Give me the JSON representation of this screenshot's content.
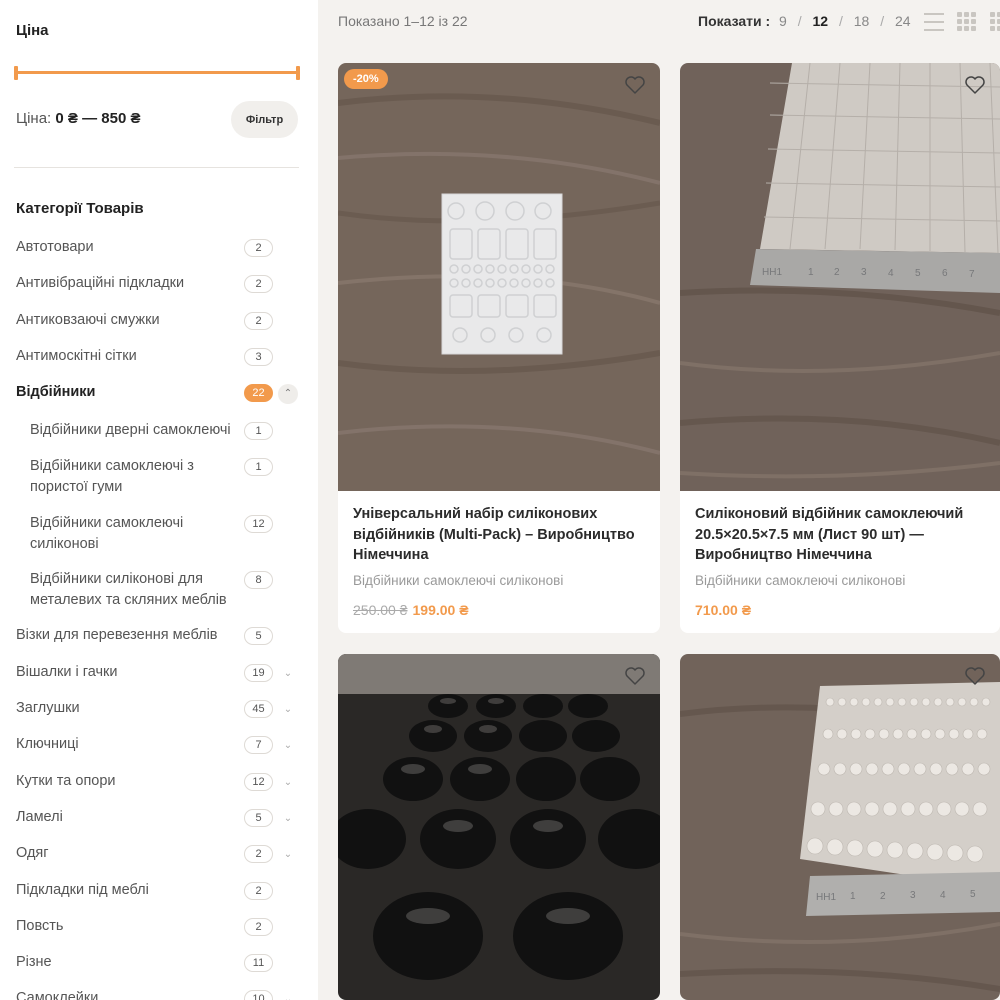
{
  "sidebar": {
    "price_title": "Ціна",
    "price_label": "Ціна:",
    "price_min": "0 ₴",
    "price_sep": "—",
    "price_max": "850 ₴",
    "filter_button": "Фільтр",
    "categories_title": "Категорії Товарів",
    "categories": [
      {
        "label": "Автотовари",
        "count": "2"
      },
      {
        "label": "Антивібраційні підкладки",
        "count": "2"
      },
      {
        "label": "Антиковзаючі смужки",
        "count": "2"
      },
      {
        "label": "Антимоскітні сітки",
        "count": "3"
      },
      {
        "label": "Відбійники",
        "count": "22"
      },
      {
        "label": "Візки для перевезення меблів",
        "count": "5"
      },
      {
        "label": "Вішалки і гачки",
        "count": "19"
      },
      {
        "label": "Заглушки",
        "count": "45"
      },
      {
        "label": "Ключниці",
        "count": "7"
      },
      {
        "label": "Кутки та опори",
        "count": "12"
      },
      {
        "label": "Ламелі",
        "count": "5"
      },
      {
        "label": "Одяг",
        "count": "2"
      },
      {
        "label": "Підкладки під меблі",
        "count": "2"
      },
      {
        "label": "Повсть",
        "count": "2"
      },
      {
        "label": "Різне",
        "count": "11"
      },
      {
        "label": "Самоклейки",
        "count": "10"
      }
    ],
    "subcategories": [
      {
        "label": "Відбійники дверні самоклеючі",
        "count": "1"
      },
      {
        "label": "Відбійники самоклеючі з пористої гуми",
        "count": "1"
      },
      {
        "label": "Відбійники самоклеючі силіконові",
        "count": "12"
      },
      {
        "label": "Відбійники силіконові для металевих та скляних меблів",
        "count": "8"
      }
    ]
  },
  "toolbar": {
    "result_count": "Показано 1–12 із 22",
    "per_page_label": "Показати :",
    "per_page_options": [
      "9",
      "12",
      "18",
      "24"
    ],
    "per_page_current": "12",
    "separator": "/"
  },
  "products": [
    {
      "title": "Універсальний набір силіконових відбійників (Multi-Pack) – Виробництво Німеччина",
      "category": "Відбійники самоклеючі силіконові",
      "old_price": "250.00 ₴",
      "price": "199.00 ₴",
      "badge": "-20%"
    },
    {
      "title": "Силіконовий відбійник самоклеючий 20.5×20.5×7.5 мм (Лист 90 шт) — Виробництво Німеччина",
      "category": "Відбійники самоклеючі силіконові",
      "price": "710.00 ₴"
    }
  ],
  "ruler_labels": [
    "HH1",
    "1",
    "2",
    "3",
    "4",
    "5",
    "6",
    "7"
  ],
  "icons": {
    "wishlist": "heart-outline-icon",
    "list_view": "list-view-icon",
    "grid_view": "grid-view-icon",
    "toggle_open": "chevron-up-icon",
    "toggle_closed": "chevron-down-icon"
  },
  "colors": {
    "accent": "#f29a4c",
    "background": "#f4f2ef",
    "wood": "#74655a"
  }
}
